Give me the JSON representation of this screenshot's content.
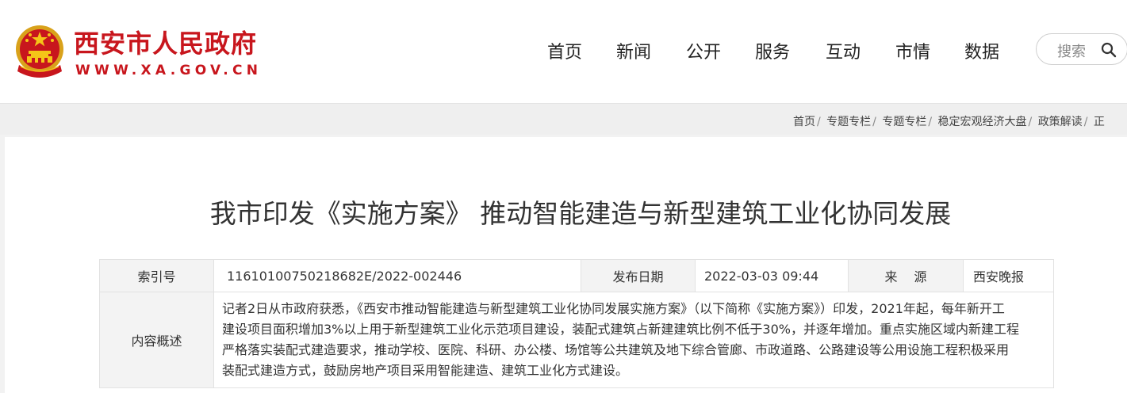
{
  "header": {
    "site_name": "西安市人民政府",
    "site_domain": "WWW.XA.GOV.CN",
    "brand_color": "#c8161d",
    "nav": [
      "首页",
      "新闻",
      "公开",
      "服务",
      "互动",
      "市情",
      "数据"
    ],
    "search_placeholder": "搜索",
    "emblem_icon": "national-emblem"
  },
  "breadcrumb": [
    "首页",
    "专题专栏",
    "专题专栏",
    "稳定宏观经济大盘",
    "政策解读",
    "正"
  ],
  "article": {
    "title": "我市印发《实施方案》 推动智能建造与新型建筑工业化协同发展"
  },
  "info": {
    "index_label": "索引号",
    "index_value": "11610100750218682E/2022-002446",
    "date_label": "发布日期",
    "date_value": "2022-03-03 09:44",
    "source_label": "来　 源",
    "source_value": "西安晚报",
    "summary_label": "内容概述",
    "summary_lines": [
      "记者2日从市政府获悉，《西安市推动智能建造与新型建筑工业化协同发展实施方案》（以下简称《实施方案》）印发，2021年起，每年新开工",
      "建设项目面积增加3%以上用于新型建筑工业化示范项目建设，装配式建筑占新建建筑比例不低于30%，并逐年增加。重点实施区域内新建工程",
      "严格落实装配式建造要求，推动学校、医院、科研、办公楼、场馆等公共建筑及地下综合管廊、市政道路、公路建设等公用设施工程积极采用",
      "装配式建造方式，鼓励房地产项目采用智能建造、建筑工业化方式建设。"
    ]
  }
}
